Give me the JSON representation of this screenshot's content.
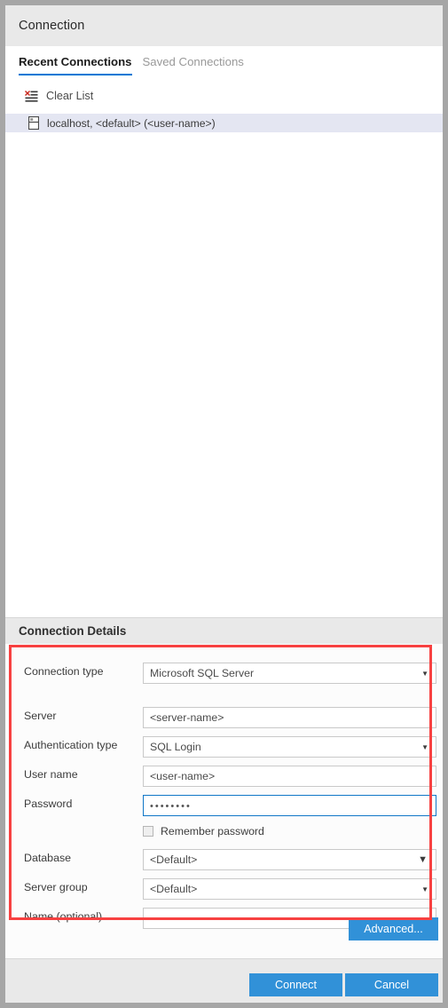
{
  "window": {
    "title": "Connection"
  },
  "tabs": [
    {
      "label": "Recent Connections",
      "active": true,
      "name": "tab-recent-connections"
    },
    {
      "label": "Saved Connections",
      "active": false,
      "name": "tab-saved-connections"
    }
  ],
  "recent_list": {
    "clear_list_label": "Clear List",
    "clear_list_icon": "clear-list-icon",
    "items": [
      {
        "label": "localhost, <default> (<user-name>)",
        "icon": "server-icon",
        "selected": true
      }
    ]
  },
  "details": {
    "header": "Connection Details",
    "fields": [
      {
        "label": "Connection type",
        "value": "Microsoft SQL Server",
        "type": "select",
        "arrow": "chevron-down-icon"
      },
      {
        "label": "Server",
        "value": "<server-name>",
        "type": "text"
      },
      {
        "label": "Authentication type",
        "value": "SQL Login",
        "type": "select",
        "arrow": "chevron-down-icon"
      },
      {
        "label": "User name",
        "value": "<user-name>",
        "type": "text"
      },
      {
        "label": "Password",
        "value": "••••••••",
        "type": "password",
        "focused": true
      },
      {
        "label": "Database",
        "value": "<Default>",
        "type": "select",
        "arrow": "chevron-down-icon"
      },
      {
        "label": "Server group",
        "value": "<Default>",
        "type": "select",
        "arrow": "chevron-down-icon"
      },
      {
        "label": "Name (optional)",
        "value": "",
        "type": "text"
      }
    ],
    "remember_password": {
      "label": "Remember password",
      "checked": false
    },
    "advanced_button": "Advanced..."
  },
  "footer": {
    "connect_button": "Connect",
    "cancel_button": "Cancel"
  },
  "colors": {
    "accent_blue": "#3191d8",
    "tab_underline": "#0078d4",
    "highlight_red": "#f74141",
    "selected_row": "#e4e6f2",
    "chrome_gray": "#e9e9e9",
    "window_frame": "#a6a6a6",
    "focus_border": "#1177c7"
  }
}
